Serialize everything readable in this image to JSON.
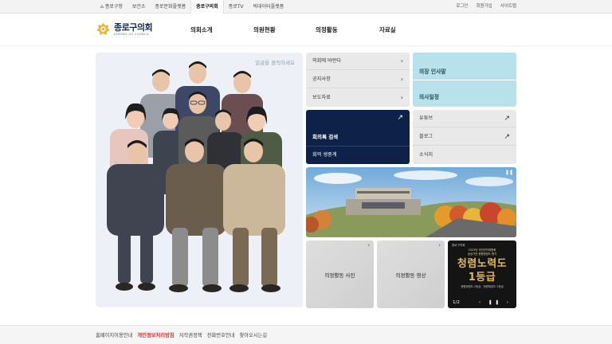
{
  "topbar": {
    "nav": [
      {
        "label": "종로구청",
        "icon": "home-icon"
      },
      {
        "label": "보건소"
      },
      {
        "label": "종로문화플랫폼"
      },
      {
        "label": "종로구의회",
        "active": true
      },
      {
        "label": "종로TV"
      },
      {
        "label": "빅데이터플랫폼"
      }
    ],
    "util": [
      "로그인",
      "회원가입",
      "사이트맵"
    ]
  },
  "header": {
    "logo_title": "종로구의회",
    "logo_sub": "JONGNO-GU COUNCIL",
    "gnb": [
      "의회소개",
      "의원현황",
      "의정활동",
      "자료실"
    ]
  },
  "hero": {
    "hint": "얼굴을 클릭하세요"
  },
  "quick_links": [
    {
      "label": "의회에 바란다",
      "icon": "chevron-right-icon"
    },
    {
      "label": "공지사항",
      "icon": "chevron-right-icon"
    },
    {
      "label": "보도자료",
      "icon": "chevron-right-icon"
    }
  ],
  "greeting": {
    "item1": "의장 인사말",
    "item2": "의사일정"
  },
  "minutes": {
    "item1": "회의록 검색",
    "item2": "회의 생중계"
  },
  "social": [
    {
      "label": "유튜브",
      "icon": "arrow-up-right-icon"
    },
    {
      "label": "블로그",
      "icon": "arrow-up-right-icon"
    },
    {
      "label": "소식지"
    }
  ],
  "banner": {
    "pause": "❚❚"
  },
  "tiles": [
    {
      "label": "의정활동 사진"
    },
    {
      "label": "의정활동 영상"
    }
  ],
  "promo": {
    "badge": "종로구의회",
    "small": "2023년 국민권익위원회\n공공기관 종합청렴도 평가",
    "big1": "청렴노력도",
    "big2": "1등급",
    "cap": "종합청렴도 2등급 · 청렴체감도 2등급",
    "pager": "1/2",
    "controls": "‹ ❚❚ ›"
  },
  "footer": {
    "links": [
      {
        "label": "홈페이지이용안내"
      },
      {
        "label": "개인정보처리방침",
        "highlight": true
      },
      {
        "label": "저작권정책"
      },
      {
        "label": "전화번호안내"
      },
      {
        "label": "찾아오시는길"
      }
    ]
  },
  "colors": {
    "navy": "#0e2249",
    "cyan_panel": "#b7e2ec",
    "gray_panel": "#e9e9e9",
    "footer_red": "#d0312d",
    "gold": "#e0b761"
  }
}
